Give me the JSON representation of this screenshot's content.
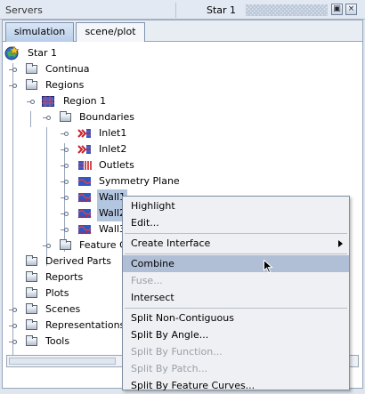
{
  "titlebar": {
    "servers": "Servers",
    "star": "Star 1",
    "btn_restore": "▣",
    "btn_close": "×"
  },
  "tabs": [
    {
      "label": "simulation",
      "active": true
    },
    {
      "label": "scene/plot",
      "active": false
    }
  ],
  "tree": {
    "root": "Star 1",
    "continua": "Continua",
    "regions": "Regions",
    "region1": "Region 1",
    "boundaries": "Boundaries",
    "inlet1": "Inlet1",
    "inlet2": "Inlet2",
    "outlets": "Outlets",
    "symmetry": "Symmetry Plane",
    "wall1": "Wall1",
    "wall2": "Wall2",
    "wall3": "Wall3",
    "feature": "Feature C",
    "derived": "Derived Parts",
    "reports": "Reports",
    "plots": "Plots",
    "scenes": "Scenes",
    "representations": "Representations",
    "tools": "Tools"
  },
  "menu": {
    "highlight": "Highlight",
    "edit": "Edit...",
    "create_interface": "Create Interface",
    "combine": "Combine",
    "fuse": "Fuse...",
    "intersect": "Intersect",
    "split_noncontig": "Split Non-Contiguous",
    "split_angle": "Split By Angle...",
    "split_function": "Split By Function...",
    "split_patch": "Split By Patch...",
    "split_feature": "Split By Feature Curves..."
  },
  "colors": {
    "selection": "#b3c6e0",
    "menu_highlight": "#b0bfd6",
    "inlet_red": "#c8202a",
    "boundary_blue": "#2f58c9"
  }
}
